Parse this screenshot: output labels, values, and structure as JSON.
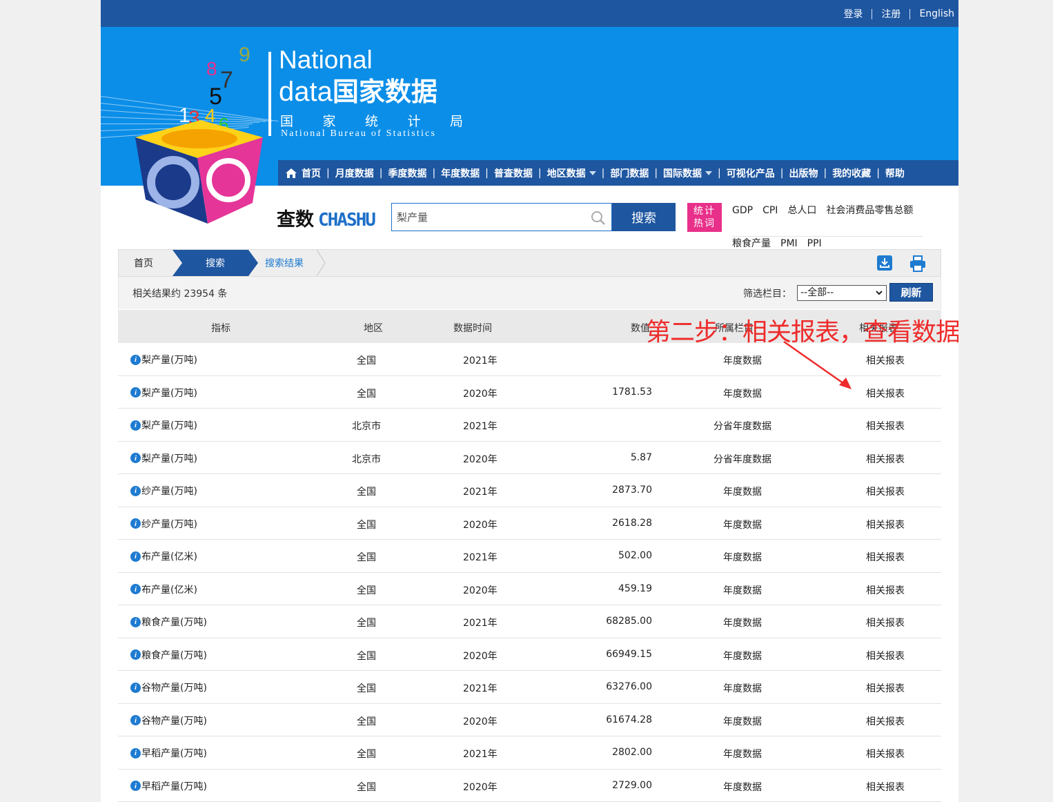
{
  "top_links": [
    "登录",
    "注册",
    "English"
  ],
  "logo": {
    "en1": "National",
    "en2a": "data",
    "cn_title": "国家数据",
    "cn_chars": [
      "国",
      "家",
      "统",
      "计",
      "局"
    ],
    "sub": "National Bureau of Statistics"
  },
  "nav": [
    {
      "label": "首页",
      "icon": "home-icon"
    },
    {
      "label": "月度数据"
    },
    {
      "label": "季度数据"
    },
    {
      "label": "年度数据"
    },
    {
      "label": "普查数据"
    },
    {
      "label": "地区数据",
      "dropdown": true
    },
    {
      "label": "部门数据"
    },
    {
      "label": "国际数据",
      "dropdown": true
    },
    {
      "label": "可视化产品"
    },
    {
      "label": "出版物"
    },
    {
      "label": "我的收藏"
    },
    {
      "label": "帮助"
    }
  ],
  "search": {
    "brand_cn": "查数",
    "brand_en": "CHASHU",
    "value": "梨产量",
    "button": "搜索",
    "hot_badge": [
      "统计",
      "热词"
    ],
    "hot_row1": [
      "GDP",
      "CPI",
      "总人口",
      "社会消费品零售总额"
    ],
    "hot_row2": [
      "粮食产量",
      "PMI",
      "PPI"
    ]
  },
  "breadcrumb": {
    "home": "首页",
    "search": "搜索",
    "result": "搜索结果"
  },
  "results": {
    "count_text": "相关结果约 23954 条",
    "filter_label": "筛选栏目：",
    "filter_value": "--全部--",
    "refresh": "刷新"
  },
  "table": {
    "headers": [
      "指标",
      "地区",
      "数据时间",
      "数值",
      "所属栏目",
      "相关报表"
    ],
    "rows": [
      {
        "indicator": "梨产量(万吨)",
        "region": "全国",
        "time": "2021年",
        "value": "",
        "column": "年度数据",
        "link": "相关报表"
      },
      {
        "indicator": "梨产量(万吨)",
        "region": "全国",
        "time": "2020年",
        "value": "1781.53",
        "column": "年度数据",
        "link": "相关报表"
      },
      {
        "indicator": "梨产量(万吨)",
        "region": "北京市",
        "time": "2021年",
        "value": "",
        "column": "分省年度数据",
        "link": "相关报表"
      },
      {
        "indicator": "梨产量(万吨)",
        "region": "北京市",
        "time": "2020年",
        "value": "5.87",
        "column": "分省年度数据",
        "link": "相关报表"
      },
      {
        "indicator": "纱产量(万吨)",
        "region": "全国",
        "time": "2021年",
        "value": "2873.70",
        "column": "年度数据",
        "link": "相关报表"
      },
      {
        "indicator": "纱产量(万吨)",
        "region": "全国",
        "time": "2020年",
        "value": "2618.28",
        "column": "年度数据",
        "link": "相关报表"
      },
      {
        "indicator": "布产量(亿米)",
        "region": "全国",
        "time": "2021年",
        "value": "502.00",
        "column": "年度数据",
        "link": "相关报表"
      },
      {
        "indicator": "布产量(亿米)",
        "region": "全国",
        "time": "2020年",
        "value": "459.19",
        "column": "年度数据",
        "link": "相关报表"
      },
      {
        "indicator": "粮食产量(万吨)",
        "region": "全国",
        "time": "2021年",
        "value": "68285.00",
        "column": "年度数据",
        "link": "相关报表"
      },
      {
        "indicator": "粮食产量(万吨)",
        "region": "全国",
        "time": "2020年",
        "value": "66949.15",
        "column": "年度数据",
        "link": "相关报表"
      },
      {
        "indicator": "谷物产量(万吨)",
        "region": "全国",
        "time": "2021年",
        "value": "63276.00",
        "column": "年度数据",
        "link": "相关报表"
      },
      {
        "indicator": "谷物产量(万吨)",
        "region": "全国",
        "time": "2020年",
        "value": "61674.28",
        "column": "年度数据",
        "link": "相关报表"
      },
      {
        "indicator": "早稻产量(万吨)",
        "region": "全国",
        "time": "2021年",
        "value": "2802.00",
        "column": "年度数据",
        "link": "相关报表"
      },
      {
        "indicator": "早稻产量(万吨)",
        "region": "全国",
        "time": "2020年",
        "value": "2729.00",
        "column": "年度数据",
        "link": "相关报表"
      }
    ]
  },
  "annotation": "第二步：相关报表，查看数据",
  "colors": {
    "brand_dark": "#1e56a0",
    "banner": "#0b8ee8",
    "hot": "#e8308a",
    "annotation": "#ee2b2b",
    "link": "#1e7bd0"
  }
}
